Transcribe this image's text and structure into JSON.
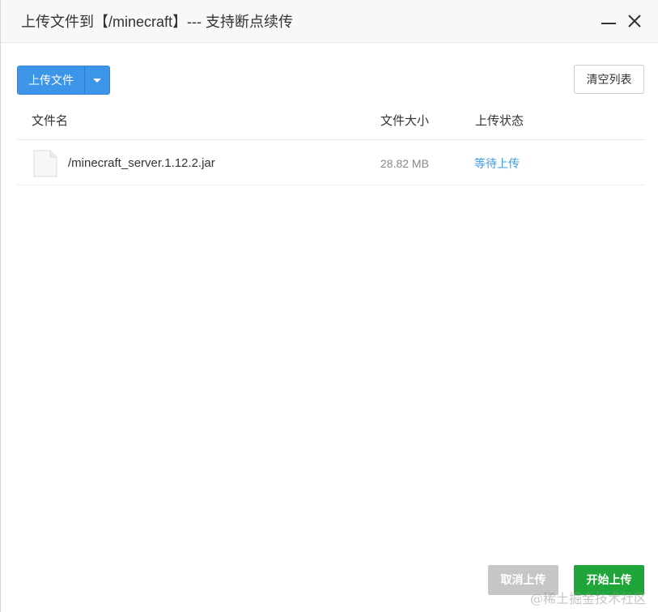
{
  "dialog": {
    "title": "上传文件到【/minecraft】--- 支持断点续传"
  },
  "window_controls": {
    "minimize_icon": "minimize-icon",
    "close_icon": "close-icon"
  },
  "toolbar": {
    "upload_label": "上传文件",
    "dropdown_icon": "chevron-down-icon",
    "clear_label": "清空列表"
  },
  "table": {
    "columns": [
      "文件名",
      "文件大小",
      "上传状态"
    ],
    "rows": [
      {
        "icon": "file-icon",
        "name": "/minecraft_server.1.12.2.jar",
        "size": "28.82 MB",
        "status": "等待上传"
      }
    ]
  },
  "footer": {
    "cancel_label": "取消上传",
    "start_label": "开始上传"
  },
  "watermark": "@稀土掘金技术社区",
  "colors": {
    "primary_blue": "#3d95e9",
    "status_blue": "#3b9ae0",
    "start_green": "#20a53a",
    "cancel_gray": "#c6c6c6"
  }
}
